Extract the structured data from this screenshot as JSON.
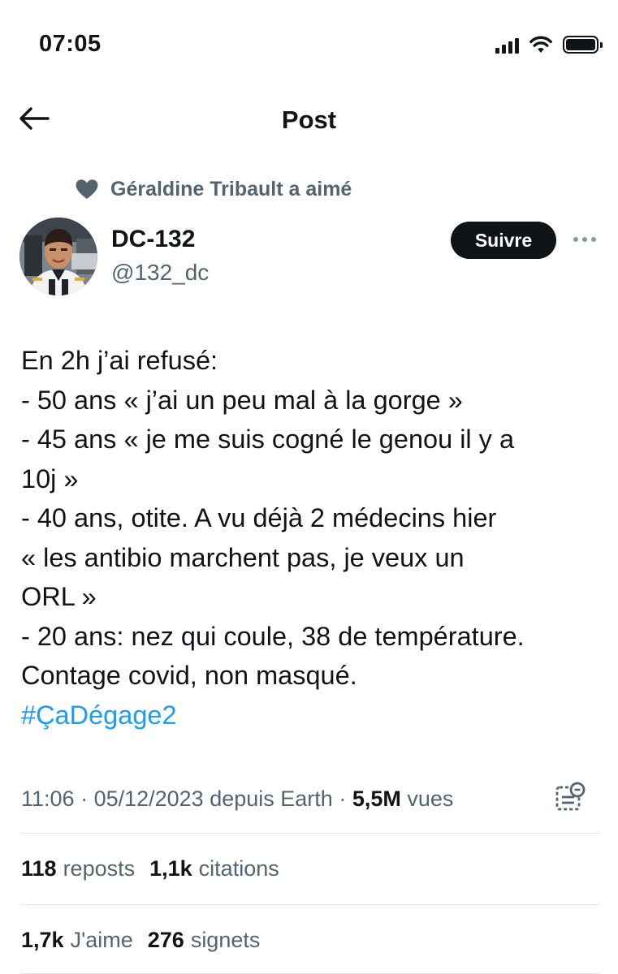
{
  "status_bar": {
    "time": "07:05",
    "icons": [
      "cellular-signal-icon",
      "wifi-icon",
      "battery-icon"
    ]
  },
  "nav": {
    "title": "Post",
    "back_icon": "back-arrow-icon"
  },
  "social_context": {
    "icon": "heart-icon",
    "text": "Géraldine Tribault a aimé"
  },
  "author": {
    "display_name": "DC-132",
    "handle": "@132_dc",
    "follow_label": "Suivre",
    "more_icon": "more-options-icon"
  },
  "tweet": {
    "lines": [
      "En 2h j’ai refusé:",
      "- 50 ans « j’ai un peu mal à la gorge »",
      "- 45 ans « je me suis cogné le genou il y a",
      "10j »",
      "- 40 ans, otite. A vu déjà 2 médecins hier",
      "« les antibio marchent pas, je veux un",
      "ORL »",
      "- 20 ans: nez qui coule, 38 de température.",
      "Contage covid, non masqué."
    ],
    "hashtag": "#ÇaDégage2"
  },
  "meta": {
    "time": "11:06",
    "separator": " · ",
    "date": "05/12/2023",
    "source": "depuis Earth",
    "views_count": "5,5M",
    "views_label": "vues",
    "analytics_icon": "post-analytics-icon"
  },
  "stats": {
    "reposts_count": "118",
    "reposts_label": "reposts",
    "quotes_count": "1,1k",
    "quotes_label": "citations",
    "likes_count": "1,7k",
    "likes_label": "J'aime",
    "bookmarks_count": "276",
    "bookmarks_label": "signets"
  },
  "colors": {
    "text_primary": "#0f1419",
    "text_secondary": "#536471",
    "link": "#1d9bf0",
    "follow_button_bg": "#0f1419",
    "divider": "#e4e8eb"
  }
}
